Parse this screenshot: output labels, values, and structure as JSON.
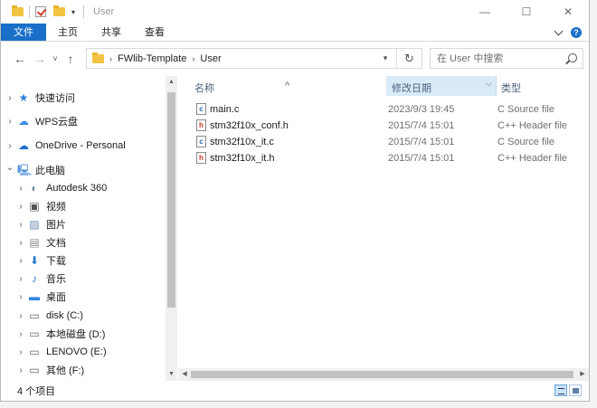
{
  "window": {
    "title": "User",
    "controls": {
      "minimize": "—",
      "maximize": "☐",
      "close": "✕"
    }
  },
  "ribbon": {
    "tabs": [
      "文件",
      "主页",
      "共享",
      "查看"
    ]
  },
  "address": {
    "crumbs": [
      "FWlib-Template",
      "User"
    ],
    "search_placeholder": "在 User 中搜索"
  },
  "nav": {
    "items": [
      {
        "label": "快速访问",
        "icon": "star-icon",
        "expanded": false
      },
      {
        "label": "WPS云盘",
        "icon": "cloud-icon",
        "expanded": false
      },
      {
        "label": "OneDrive - Personal",
        "icon": "onedrive-icon",
        "expanded": false
      },
      {
        "label": "此电脑",
        "icon": "computer-icon",
        "expanded": true
      },
      {
        "label": "Autodesk 360",
        "icon": "autodesk-icon",
        "expanded": false
      },
      {
        "label": "视频",
        "icon": "video-icon",
        "expanded": false
      },
      {
        "label": "图片",
        "icon": "pictures-icon",
        "expanded": false
      },
      {
        "label": "文档",
        "icon": "documents-icon",
        "expanded": false
      },
      {
        "label": "下载",
        "icon": "download-icon",
        "expanded": false
      },
      {
        "label": "音乐",
        "icon": "music-icon",
        "expanded": false
      },
      {
        "label": "桌面",
        "icon": "desktop-icon",
        "expanded": false
      },
      {
        "label": "disk (C:)",
        "icon": "drive-icon",
        "expanded": false
      },
      {
        "label": "本地磁盘 (D:)",
        "icon": "drive-icon",
        "expanded": false
      },
      {
        "label": "LENOVO (E:)",
        "icon": "drive-icon",
        "expanded": false
      },
      {
        "label": "其他 (F:)",
        "icon": "drive-icon",
        "expanded": false
      }
    ]
  },
  "columns": {
    "name": "名称",
    "date": "修改日期",
    "type": "类型"
  },
  "files": [
    {
      "name": "main.c",
      "date": "2023/9/3 19:45",
      "type": "C Source file",
      "icon": "c-file-icon"
    },
    {
      "name": "stm32f10x_conf.h",
      "date": "2015/7/4 15:01",
      "type": "C++ Header file",
      "icon": "h-file-icon"
    },
    {
      "name": "stm32f10x_it.c",
      "date": "2015/7/4 15:01",
      "type": "C Source file",
      "icon": "c-file-icon"
    },
    {
      "name": "stm32f10x_it.h",
      "date": "2015/7/4 15:01",
      "type": "C++ Header file",
      "icon": "h-file-icon"
    }
  ],
  "status": {
    "count": "4 个项目"
  },
  "colors": {
    "accent": "#1a6fc9",
    "sort_column": "#d9ebf9"
  }
}
